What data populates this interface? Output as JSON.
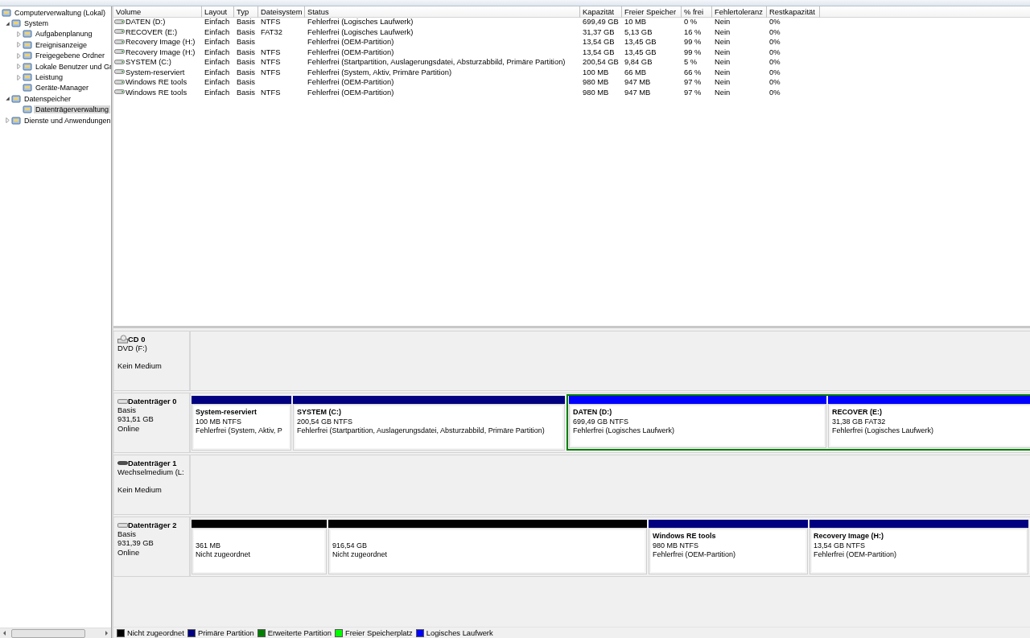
{
  "tree": [
    {
      "label": "Computerverwaltung (Lokal)",
      "kind": "root",
      "selected": false,
      "children": [
        {
          "label": "System",
          "kind": "folder",
          "expanded": true,
          "selected": false,
          "children": [
            {
              "label": "Aufgabenplanung",
              "kind": "folder",
              "expanded": false,
              "selected": false
            },
            {
              "label": "Ereignisanzeige",
              "kind": "folder",
              "expanded": false,
              "selected": false
            },
            {
              "label": "Freigegebene Ordner",
              "kind": "folder",
              "expanded": false,
              "selected": false
            },
            {
              "label": "Lokale Benutzer und Gr",
              "kind": "folder",
              "expanded": false,
              "selected": false
            },
            {
              "label": "Leistung",
              "kind": "folder",
              "expanded": false,
              "selected": false
            },
            {
              "label": "Geräte-Manager",
              "kind": "leaf",
              "selected": false
            }
          ]
        },
        {
          "label": "Datenspeicher",
          "kind": "folder",
          "expanded": true,
          "selected": false,
          "children": [
            {
              "label": "Datenträgerverwaltung",
              "kind": "leaf",
              "selected": true
            }
          ]
        },
        {
          "label": "Dienste und Anwendungen",
          "kind": "folder",
          "expanded": false,
          "selected": false
        }
      ]
    }
  ],
  "volumes": {
    "columns": [
      "Volume",
      "Layout",
      "Typ",
      "Dateisystem",
      "Status",
      "Kapazität",
      "Freier Speicher",
      "% frei",
      "Fehlertoleranz",
      "Restkapazität"
    ],
    "rows": [
      [
        "DATEN (D:)",
        "Einfach",
        "Basis",
        "NTFS",
        "Fehlerfrei (Logisches Laufwerk)",
        "699,49 GB",
        "10 MB",
        "0 %",
        "Nein",
        "0%"
      ],
      [
        "RECOVER (E:)",
        "Einfach",
        "Basis",
        "FAT32",
        "Fehlerfrei (Logisches Laufwerk)",
        "31,37 GB",
        "5,13 GB",
        "16 %",
        "Nein",
        "0%"
      ],
      [
        "Recovery Image (H:)",
        "Einfach",
        "Basis",
        "",
        "Fehlerfrei (OEM-Partition)",
        "13,54 GB",
        "13,45 GB",
        "99 %",
        "Nein",
        "0%"
      ],
      [
        "Recovery Image (H:)",
        "Einfach",
        "Basis",
        "NTFS",
        "Fehlerfrei (OEM-Partition)",
        "13,54 GB",
        "13,45 GB",
        "99 %",
        "Nein",
        "0%"
      ],
      [
        "SYSTEM (C:)",
        "Einfach",
        "Basis",
        "NTFS",
        "Fehlerfrei (Startpartition, Auslagerungsdatei, Absturzabbild, Primäre Partition)",
        "200,54 GB",
        "9,84 GB",
        "5 %",
        "Nein",
        "0%"
      ],
      [
        "System-reserviert",
        "Einfach",
        "Basis",
        "NTFS",
        "Fehlerfrei (System, Aktiv, Primäre Partition)",
        "100 MB",
        "66 MB",
        "66 %",
        "Nein",
        "0%"
      ],
      [
        "Windows RE tools",
        "Einfach",
        "Basis",
        "",
        "Fehlerfrei (OEM-Partition)",
        "980 MB",
        "947 MB",
        "97 %",
        "Nein",
        "0%"
      ],
      [
        "Windows RE tools",
        "Einfach",
        "Basis",
        "NTFS",
        "Fehlerfrei (OEM-Partition)",
        "980 MB",
        "947 MB",
        "97 %",
        "Nein",
        "0%"
      ]
    ]
  },
  "disks": [
    {
      "kind": "cd",
      "name": "CD 0",
      "lines": [
        "DVD (F:)",
        "Kein Medium"
      ]
    },
    {
      "kind": "disk",
      "name": "Datenträger 0",
      "lines": [
        "Basis",
        "931,51 GB",
        "Online"
      ],
      "partitions": [
        {
          "kind": "primary",
          "name": "System-reserviert",
          "size": "100 MB NTFS",
          "status": "Fehlerfrei (System, Aktiv, P"
        },
        {
          "kind": "primary",
          "name": "SYSTEM  (C:)",
          "size": "200,54 GB NTFS",
          "status": "Fehlerfrei (Startpartition, Auslagerungsdatei, Absturzabbild, Primäre Partition)"
        },
        {
          "kind": "extended",
          "children": [
            {
              "kind": "logical",
              "name": "DATEN  (D:)",
              "size": "699,49 GB NTFS",
              "status": "Fehlerfrei (Logisches Laufwerk)"
            },
            {
              "kind": "logical",
              "name": "RECOVER  (E:)",
              "size": "31,38 GB FAT32",
              "status": "Fehlerfrei (Logisches Laufwerk)"
            }
          ]
        }
      ]
    },
    {
      "kind": "removable",
      "name": "Datenträger 1",
      "lines": [
        "Wechselmedium (L:",
        "Kein Medium"
      ]
    },
    {
      "kind": "disk",
      "name": "Datenträger 2",
      "lines": [
        "Basis",
        "931,39 GB",
        "Online"
      ],
      "partitions": [
        {
          "kind": "unallocated",
          "size": "361 MB",
          "status": "Nicht zugeordnet"
        },
        {
          "kind": "unallocated",
          "size": "916,54 GB",
          "status": "Nicht zugeordnet"
        },
        {
          "kind": "primary",
          "name": "Windows RE tools",
          "size": "980 MB NTFS",
          "status": "Fehlerfrei (OEM-Partition)"
        },
        {
          "kind": "primary",
          "name": "Recovery Image  (H:)",
          "size": "13,54 GB NTFS",
          "status": "Fehlerfrei (OEM-Partition)"
        }
      ]
    }
  ],
  "legend": [
    {
      "label": "Nicht zugeordnet",
      "color": "#000000"
    },
    {
      "label": "Primäre Partition",
      "color": "#000080"
    },
    {
      "label": "Erweiterte Partition",
      "color": "#008000"
    },
    {
      "label": "Freier Speicherplatz",
      "color": "#00ff00"
    },
    {
      "label": "Logisches Laufwerk",
      "color": "#0000ff"
    }
  ]
}
